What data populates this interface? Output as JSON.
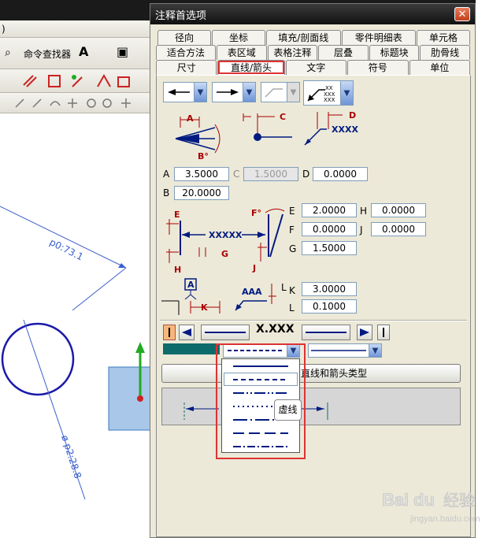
{
  "window": {
    "title": "注释首选项",
    "close_glyph": "✕"
  },
  "background": {
    "menu_glyph": ")",
    "command_finder": "命令查找器",
    "dim1": "p0:73.1",
    "dim2": "ø p2:28.8"
  },
  "tabs": [
    [
      "径向",
      "坐标",
      "填充/剖面线",
      "零件明细表",
      "单元格"
    ],
    [
      "适合方法",
      "表区域",
      "表格注释",
      "层叠",
      "标题块",
      "肋骨线"
    ],
    [
      "尺寸",
      "直线/箭头",
      "文字",
      "符号",
      "单位"
    ]
  ],
  "active_tab": "直线/箭头",
  "fields": {
    "A": "3.5000",
    "C": "1.5000",
    "D": "0.0000",
    "B": "20.0000",
    "E": "2.0000",
    "H": "0.0000",
    "F": "0.0000",
    "J": "0.0000",
    "G": "1.5000",
    "K": "3.0000",
    "L": "0.1000"
  },
  "labels": {
    "A": "A",
    "C": "C",
    "D": "D",
    "B": "B",
    "E": "E",
    "H": "H",
    "F": "F",
    "J": "J",
    "G": "G",
    "K": "K",
    "L": "L"
  },
  "diagram_text": {
    "xxxx": "XXXX",
    "xxxxx": "XXXXX",
    "aaa": "AAA",
    "A": "A",
    "B": "B°",
    "F": "F°",
    "xxx": "X.XXX",
    "grid_x": "XX\nXXX"
  },
  "wide_button": "应用于所有直线和箭头类型",
  "wide_button_visible": "直线和箭头类型",
  "tooltip": "虚线",
  "watermark": {
    "brand": "Bai",
    "paw": "du",
    "cn": "经验",
    "url": "jingyan.baidu.com"
  }
}
